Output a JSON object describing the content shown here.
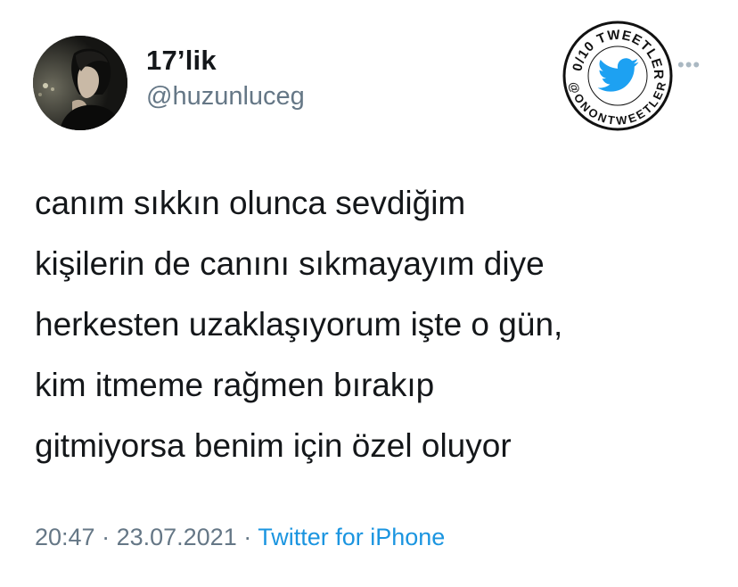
{
  "author": {
    "display_name": "17’lik",
    "handle": "@huzunluceg"
  },
  "badge": {
    "top_text": "10/10 TWEETLER",
    "bottom_text": "@ONONTWEETLER",
    "icon": "twitter-bird-icon",
    "color": "#1da1f2"
  },
  "more_menu": {
    "icon": "more-dots-icon",
    "label": "•••"
  },
  "tweet": {
    "lines": [
      "canım sıkkın olunca sevdiğim",
      "kişilerin de canını sıkmayayım diye",
      "herkesten uzaklaşıyorum işte o gün,",
      "kim itmeme rağmen bırakıp",
      "gitmiyorsa benim için özel oluyor"
    ]
  },
  "meta": {
    "time": "20:47",
    "date": "23.07.2021",
    "separator": " · ",
    "source": "Twitter for iPhone"
  },
  "colors": {
    "text": "#14171a",
    "secondary": "#657786",
    "link": "#1b95e0"
  }
}
